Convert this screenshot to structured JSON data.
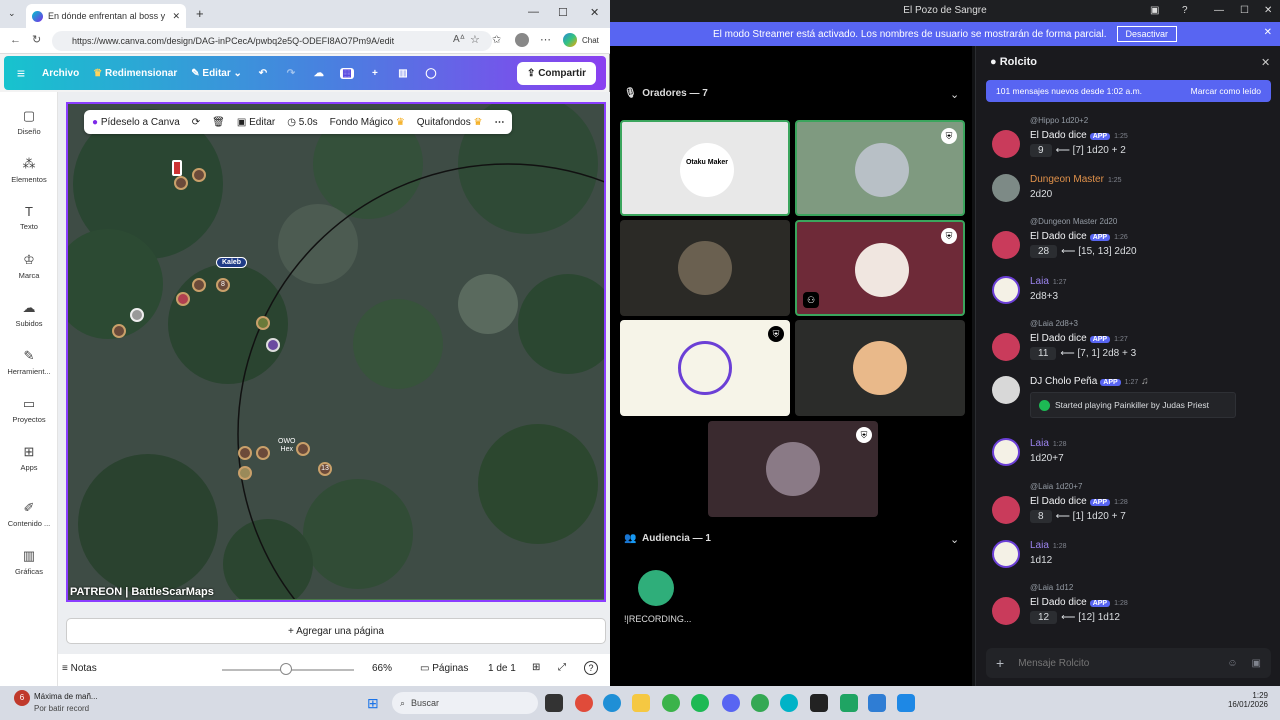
{
  "browser": {
    "tab_title": "En dónde enfrentan al boss y al cru",
    "url": "https://www.canva.com/design/DAG-inPCecA/pwbq2e5Q-ODEFI8AO7Pm9A/edit",
    "chat_label": "Chat"
  },
  "canva": {
    "menu": {
      "archivo": "Archivo",
      "redimensionar": "Redimensionar",
      "editar": "Editar",
      "compartir": "Compartir"
    },
    "sidebar": [
      "Diseño",
      "Elementos",
      "Texto",
      "Marca",
      "Subidos",
      "Herramient...",
      "Proyectos",
      "Apps",
      "Contenido ...",
      "Gráficas"
    ],
    "context_bar": {
      "ask": "Pídeselo a Canva",
      "edit": "Editar",
      "duration": "5.0s",
      "magic": "Fondo Mágico",
      "bg_remove": "Quitafondos"
    },
    "map": {
      "kaleb": "Kaleb",
      "owo": "OWO",
      "hex": "Hex",
      "token_8": "8",
      "token_13": "13",
      "watermark": "PATREON | BattleScarMaps"
    },
    "add_page": "+ Agregar una página",
    "footer": {
      "notes": "Notas",
      "zoom": "66%",
      "pages": "Páginas",
      "page_count": "1 de 1"
    }
  },
  "discord": {
    "window_title": "El Pozo de Sangre",
    "streamer_msg": "El modo Streamer está activado. Los nombres de usuario se mostrarán de forma parcial.",
    "streamer_btn": "Desactivar",
    "speakers_header": "Oradores — 7",
    "audience_header": "Audiencia — 1",
    "audience_user": "!|RECORDING...",
    "tile_name": "Otaku Maker",
    "chat": {
      "channel": "Rolcito",
      "new_msgs": "101 mensajes nuevos desde 1:02 a.m.",
      "mark_read": "Marcar como leído",
      "input_placeholder": "Mensaje Rolcito",
      "messages": [
        {
          "reply": "@Hippo 1d20+2",
          "name": "El Dado dice",
          "app": "APP",
          "time": "1:25",
          "code": "9",
          "text": "⟵ [7] 1d20 + 2"
        },
        {
          "name": "Dungeon Master",
          "time": "1:25",
          "text": "2d20"
        },
        {
          "reply": "@Dungeon Master 2d20",
          "name": "El Dado dice",
          "app": "APP",
          "time": "1:26",
          "code": "28",
          "text": "⟵ [15, 13] 2d20"
        },
        {
          "name": "Laia",
          "time": "1:27",
          "text": "2d8+3"
        },
        {
          "reply": "@Laia 2d8+3",
          "name": "El Dado dice",
          "app": "APP",
          "time": "1:27",
          "code": "11",
          "text": "⟵ [7, 1] 2d8 + 3"
        },
        {
          "name": "DJ Cholo Peña",
          "app": "APP",
          "time": "1:27",
          "text": "Started playing Painkiller by Judas Priest"
        },
        {
          "name": "Laia",
          "time": "1:28",
          "text": "1d20+7"
        },
        {
          "reply": "@Laia 1d20+7",
          "name": "El Dado dice",
          "app": "APP",
          "time": "1:28",
          "code": "8",
          "text": "⟵ [1] 1d20 + 7"
        },
        {
          "name": "Laia",
          "time": "1:28",
          "text": "1d12"
        },
        {
          "reply": "@Laia 1d12",
          "name": "El Dado dice",
          "app": "APP",
          "time": "1:28",
          "code": "12",
          "text": "⟵ [12] 1d12"
        }
      ]
    }
  },
  "taskbar": {
    "notif_title": "Máxima de mañ...",
    "notif_sub": "Por batir record",
    "notif_badge": "6",
    "search": "Buscar",
    "time": "1:29",
    "date": "16/01/2026"
  }
}
